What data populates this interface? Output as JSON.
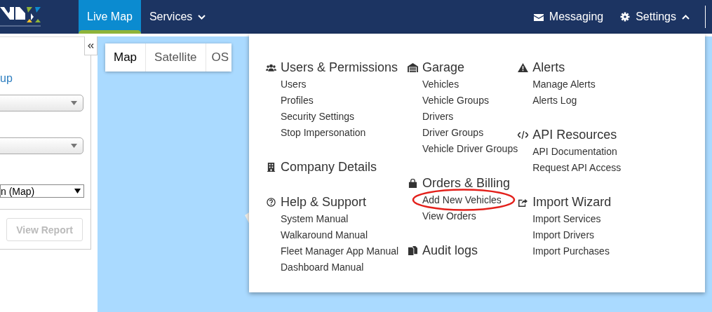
{
  "nav": {
    "left": [
      {
        "label": "Live Map",
        "kind": "link",
        "selected": true
      },
      {
        "label": "Services",
        "kind": "dropdown",
        "selected": false,
        "expanded": false
      }
    ],
    "right": [
      {
        "label": "Messaging",
        "kind": "link"
      },
      {
        "label": "Settings",
        "kind": "dropdown",
        "expanded": true
      }
    ]
  },
  "side_panel": {
    "group_label": "up",
    "report_type": {
      "value": "n (Map)"
    },
    "view_report_button": {
      "label": "View Report",
      "disabled": true
    }
  },
  "map": {
    "tabs": [
      {
        "label": "Map",
        "selected": true
      },
      {
        "label": "Satellite",
        "selected": false
      },
      {
        "label": "OS",
        "selected": false
      }
    ]
  },
  "settings_menu": {
    "columns": [
      {
        "sections": [
          {
            "title": "Users & Permissions",
            "items": [
              {
                "label": "Users",
                "circled": false
              },
              {
                "label": "Profiles",
                "circled": false
              },
              {
                "label": "Security Settings",
                "circled": false
              },
              {
                "label": "Stop Impersonation",
                "circled": false
              }
            ]
          },
          {
            "title": "Company Details"
          },
          {
            "title": "Help & Support",
            "items": [
              {
                "label": "System Manual",
                "circled": false
              },
              {
                "label": "Walkaround Manual",
                "circled": false
              },
              {
                "label": "Fleet Manager App Manual",
                "circled": false
              },
              {
                "label": "Dashboard Manual",
                "circled": false
              }
            ]
          }
        ]
      },
      {
        "sections": [
          {
            "title": "Garage",
            "items": [
              {
                "label": "Vehicles",
                "circled": false
              },
              {
                "label": "Vehicle Groups",
                "circled": false
              },
              {
                "label": "Drivers",
                "circled": false
              },
              {
                "label": "Driver Groups",
                "circled": false
              },
              {
                "label": "Vehicle Driver Groups",
                "circled": false
              }
            ]
          },
          {
            "title": "Orders & Billing",
            "items": [
              {
                "label": "Add New Vehicles",
                "circled": true
              },
              {
                "label": "View Orders",
                "circled": false
              }
            ]
          },
          {
            "title": "Audit logs"
          }
        ]
      },
      {
        "sections": [
          {
            "title": "Alerts",
            "items": [
              {
                "label": "Manage Alerts",
                "circled": false
              },
              {
                "label": "Alerts Log",
                "circled": false
              }
            ]
          },
          {
            "title": "API Resources",
            "items": [
              {
                "label": "API Documentation",
                "circled": false
              },
              {
                "label": "Request API Access",
                "circled": false
              }
            ]
          },
          {
            "title": "Import Wizard",
            "items": [
              {
                "label": "Import Services",
                "circled": false
              },
              {
                "label": "Import Drivers",
                "circled": false
              },
              {
                "label": "Import Purchases",
                "circled": false
              }
            ]
          }
        ]
      }
    ]
  }
}
